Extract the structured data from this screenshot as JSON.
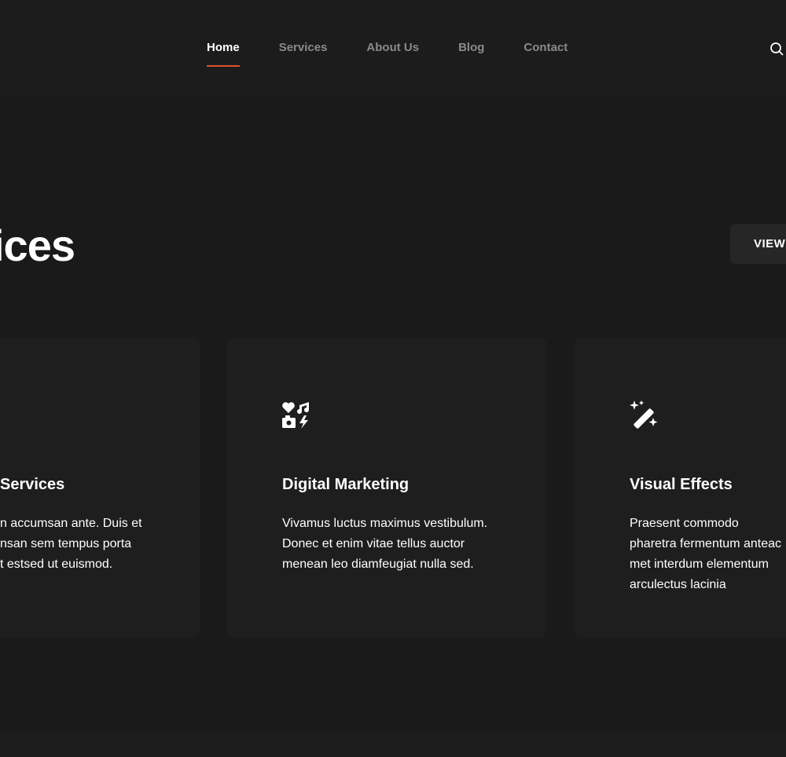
{
  "nav": {
    "items": [
      {
        "label": "Home",
        "active": true
      },
      {
        "label": "Services"
      },
      {
        "label": "About Us"
      },
      {
        "label": "Blog"
      },
      {
        "label": "Contact"
      }
    ],
    "accent": "#e0522a"
  },
  "section": {
    "title": "ices",
    "button": "VIEW"
  },
  "cards": [
    {
      "title": "Services",
      "lines": [
        "n accumsan ante. Duis et",
        "nsan sem tempus porta",
        "t estsed ut euismod."
      ],
      "icon": "none"
    },
    {
      "title": "Digital Marketing",
      "lines": [
        "Vivamus luctus maximus vestibulum.",
        "Donec et enim vitae tellus auctor",
        "menean leo diamfeugiat nulla sed."
      ],
      "icon": "media-icons"
    },
    {
      "title": "Visual Effects",
      "lines": [
        "Praesent commodo pharetra",
        "fermentum anteac met interdum",
        "elementum arculectus lacinia"
      ],
      "icon": "magic-wand"
    }
  ]
}
